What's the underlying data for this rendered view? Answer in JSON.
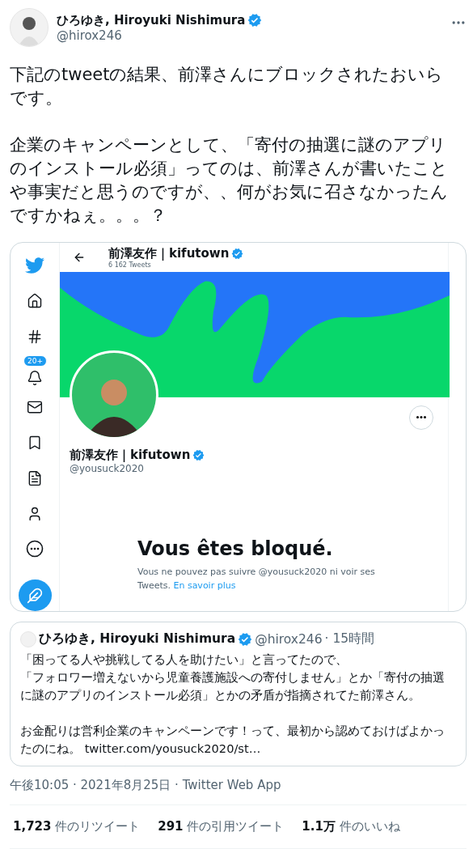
{
  "tweet": {
    "author": {
      "name": "ひろゆき, Hiroyuki Nishimura",
      "handle": "@hirox246",
      "verified": true
    },
    "paragraphs": [
      "下記のtweetの結果、前澤さんにブロックされたおいらです。",
      "企業のキャンペーンとして、「寄付の抽選に謎のアプリのインストール必須」ってのは、前澤さんが書いたことや事実だと思うのですが、、何がお気に召さなかったんですかねぇ。。。？"
    ],
    "embedded_screenshot": {
      "notification_badge": "20+",
      "header": {
        "name": "前澤友作｜kifutown",
        "verified": true,
        "tweet_count": "6 162 Tweets"
      },
      "profile": {
        "name": "前澤友作｜kifutown",
        "verified": true,
        "handle": "@yousuck2020"
      },
      "blocked": {
        "title": "Vous êtes bloqué.",
        "message": "Vous ne pouvez pas suivre @yousuck2020 ni voir ses Tweets.",
        "link": "En savoir plus"
      }
    },
    "quoted_tweet": {
      "name": "ひろゆき, Hiroyuki Nishimura",
      "verified": true,
      "handle": "@hirox246",
      "time": "· 15時間",
      "paragraphs": [
        [
          "「困ってる人や挑戦してる人を助けたい」と言ってたので、",
          "「フォロワー増えないから児童養護施設への寄付しません」とか「寄付の抽選に謎のアプリのインストール必須」とかの矛盾が指摘されてた前澤さん。"
        ],
        [
          "お金配りは営利企業のキャンペーンです！って、最初から認めておけばよかったのにね。 twitter.com/yousuck2020/st…"
        ]
      ]
    },
    "meta": "午後10:05 · 2021年8月25日 · Twitter Web App",
    "stats": [
      {
        "count": "1,723",
        "label": "件のリツイート"
      },
      {
        "count": "291",
        "label": "件の引用ツイート"
      },
      {
        "count": "1.1万",
        "label": "件のいいね"
      }
    ]
  }
}
